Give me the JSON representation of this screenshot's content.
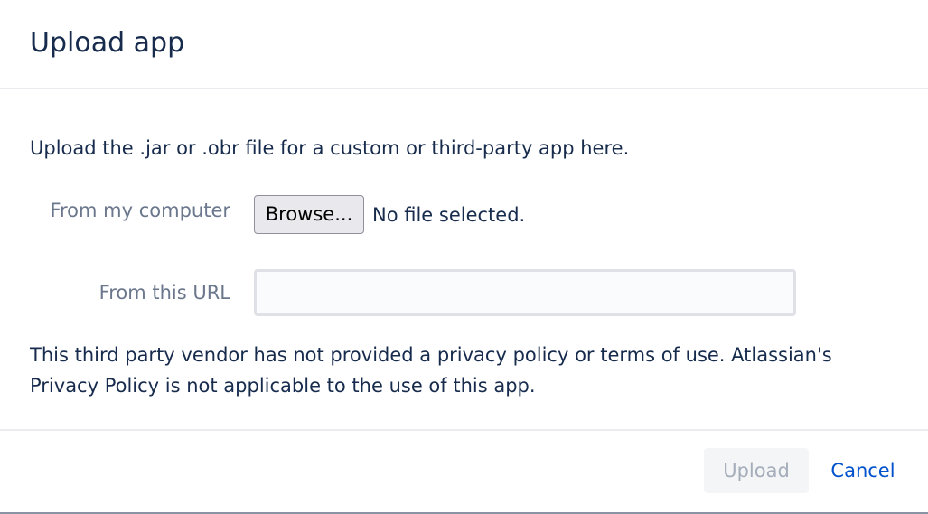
{
  "dialog": {
    "title": "Upload app"
  },
  "body": {
    "intro": "Upload the .jar or .obr file for a custom or third-party app here.",
    "from_computer_label": "From my computer",
    "browse_label": "Browse...",
    "file_status": "No file selected.",
    "from_url_label": "From this URL",
    "url_value": "",
    "url_placeholder": "",
    "privacy_notice": "This third party vendor has not provided a privacy policy or terms of use. Atlassian's Privacy Policy is not applicable to the use of this app."
  },
  "footer": {
    "upload_label": "Upload",
    "upload_enabled": false,
    "cancel_label": "Cancel"
  },
  "colors": {
    "text": "#172b4d",
    "label": "#6b778c",
    "link": "#0052cc",
    "disabled_text": "#a5adba",
    "disabled_bg": "#f4f5f7",
    "divider": "#ebecf0"
  }
}
